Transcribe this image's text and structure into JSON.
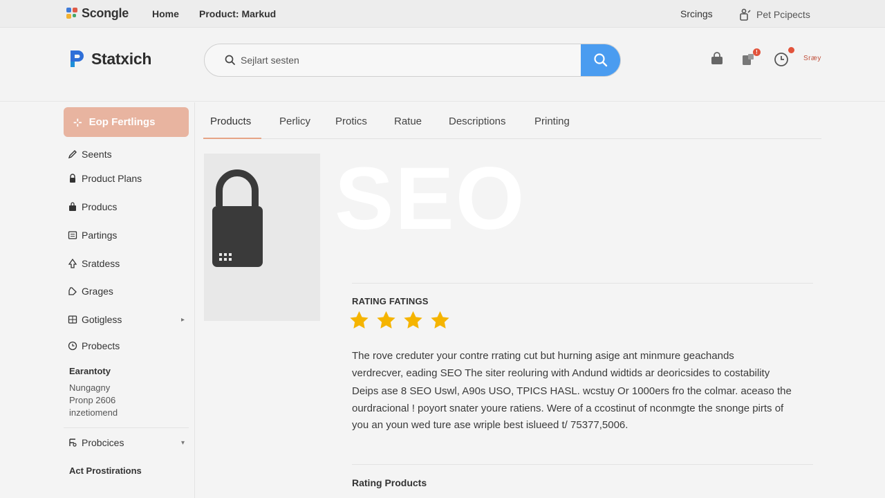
{
  "topbar": {
    "brand": "Scongle",
    "nav": [
      "Home",
      "Product: Markud"
    ],
    "right_link": "Srcings",
    "user_link": "Pet Pcipects"
  },
  "header": {
    "logo": "Statxich",
    "search_placeholder": "Sejlart sesten",
    "label": "Sræy"
  },
  "sidebar": {
    "primary": "Eop Fertlings",
    "items": [
      {
        "label": "Seents",
        "icon": "pencil-icon"
      },
      {
        "label": "Product Plans",
        "icon": "lock-icon"
      },
      {
        "label": "Producs",
        "icon": "bag-icon"
      },
      {
        "label": "Partings",
        "icon": "list-icon"
      },
      {
        "label": "Sratdess",
        "icon": "tree-icon"
      },
      {
        "label": "Grages",
        "icon": "tag-icon"
      },
      {
        "label": "Gotigless",
        "icon": "grid-icon"
      },
      {
        "label": "Probects",
        "icon": "clock-icon"
      }
    ],
    "section_title": "Earantoty",
    "section_lines": [
      "Nungagny",
      "Pronp 2606",
      "inzetiomend"
    ],
    "bottom_item": "Probcices",
    "bottom_link": "Act Prostirations"
  },
  "tabs": [
    "Products",
    "Perlicy",
    "Protics",
    "Ratue",
    "Descriptions",
    "Printing"
  ],
  "main": {
    "hero_text": "SEO",
    "rating_heading": "RATING FATINGS",
    "rating_stars": 4,
    "description": [
      "The rove creduter your contre rrating cut but hurning asige ant minmure geachands",
      "verdrecver, eading SEO The siter reoluring with Andund widtids ar deoricsides to costability",
      "Deips ase 8 SEO Uswl, A90s USO, TPICS HASL. wcstuy Or 1000ers fro the colmar. aceaso the",
      "ourdracional ! poyort snater youre ratiens. Were of a ccostinut of nconmgte the snonge pirts of",
      "you an youn wed ture ase wriple best islueed t/ 75377,5006."
    ],
    "rating_products": "Rating Products"
  },
  "colors": {
    "accent": "#e8b4a0",
    "search_button": "#4a9cf0",
    "star": "#f5b400",
    "badge": "#e2533b"
  }
}
